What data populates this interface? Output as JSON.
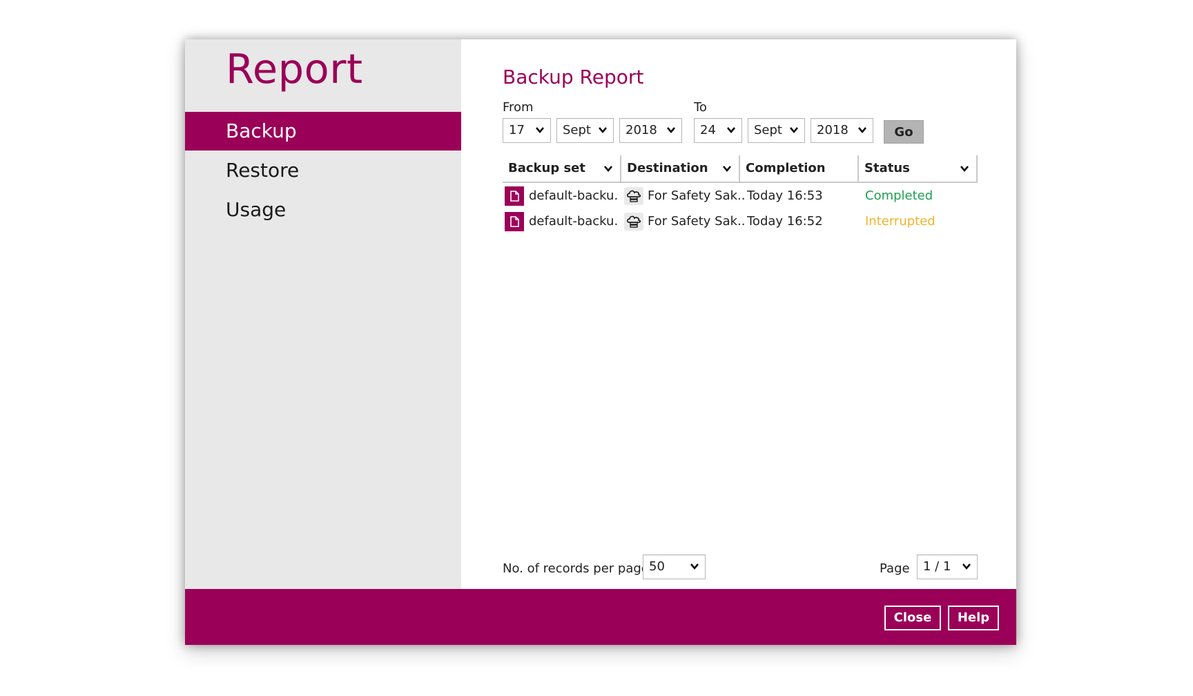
{
  "sidebar": {
    "title": "Report",
    "items": [
      {
        "label": "Backup",
        "active": true
      },
      {
        "label": "Restore",
        "active": false
      },
      {
        "label": "Usage",
        "active": false
      }
    ]
  },
  "main": {
    "title": "Backup Report",
    "from": {
      "label": "From",
      "day": "17",
      "month": "Sept",
      "year": "2018"
    },
    "to": {
      "label": "To",
      "day": "24",
      "month": "Sept",
      "year": "2018"
    },
    "go_label": "Go",
    "table": {
      "columns": [
        "Backup set",
        "Destination",
        "Completion",
        "Status"
      ],
      "rows": [
        {
          "backup_set": "default-backu...",
          "destination": "For Safety Sak...",
          "completion": "Today 16:53",
          "status": "Completed",
          "status_icon": "file-icon"
        },
        {
          "backup_set": "default-backu...",
          "destination": "For Safety Sak...",
          "completion": "Today 16:52",
          "status": "Interrupted",
          "status_icon": "file-icon"
        }
      ]
    },
    "records_label": "No. of records per page",
    "records_value": "50",
    "page_label": "Page",
    "page_value": "1 / 1"
  },
  "footer": {
    "close_label": "Close",
    "help_label": "Help"
  },
  "colors": {
    "accent": "#9b0058",
    "completed": "#1f9e50",
    "interrupted": "#f0b429"
  }
}
